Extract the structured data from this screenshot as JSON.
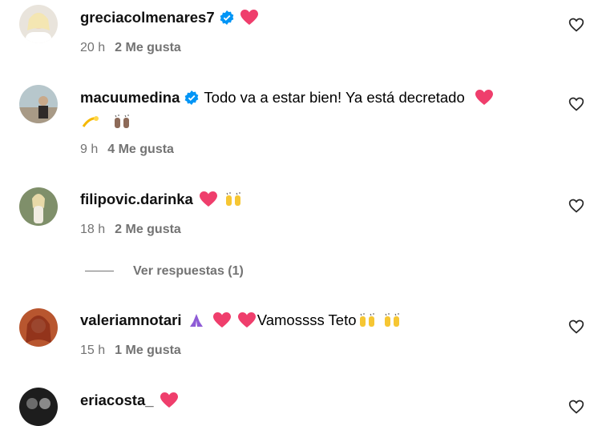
{
  "comments": [
    {
      "username": "greciacolmenares7",
      "verified": true,
      "text": "",
      "emojis": [
        "heart"
      ],
      "time": "20 h",
      "likes": "2 Me gusta"
    },
    {
      "username": "macuumedina",
      "verified": true,
      "text": "Todo va a estar bien! Ya está decretado",
      "emojis": [
        "heart"
      ],
      "line2_emojis": [
        "dizzy",
        "raised-hands-dark"
      ],
      "time": "9 h",
      "likes": "4 Me gusta"
    },
    {
      "username": "filipovic.darinka",
      "verified": false,
      "text": "",
      "emojis": [
        "heart",
        "raised-hands"
      ],
      "time": "18 h",
      "likes": "2 Me gusta"
    },
    {
      "username": "valeriamnotari",
      "verified": false,
      "text": "Vamossss Teto",
      "emojis_before": [
        "folded-hands",
        "heart",
        "heart"
      ],
      "emojis": [
        "raised-hands",
        "raised-hands"
      ],
      "time": "15 h",
      "likes": "1 Me gusta"
    },
    {
      "username": "eriacosta_",
      "verified": false,
      "text": "",
      "emojis": [
        "heart"
      ],
      "time": "",
      "likes": ""
    }
  ],
  "view_replies_label": "Ver respuestas (1)",
  "colors": {
    "heart": "#e8315b",
    "verified": "#0095f6",
    "meta": "#737373"
  }
}
